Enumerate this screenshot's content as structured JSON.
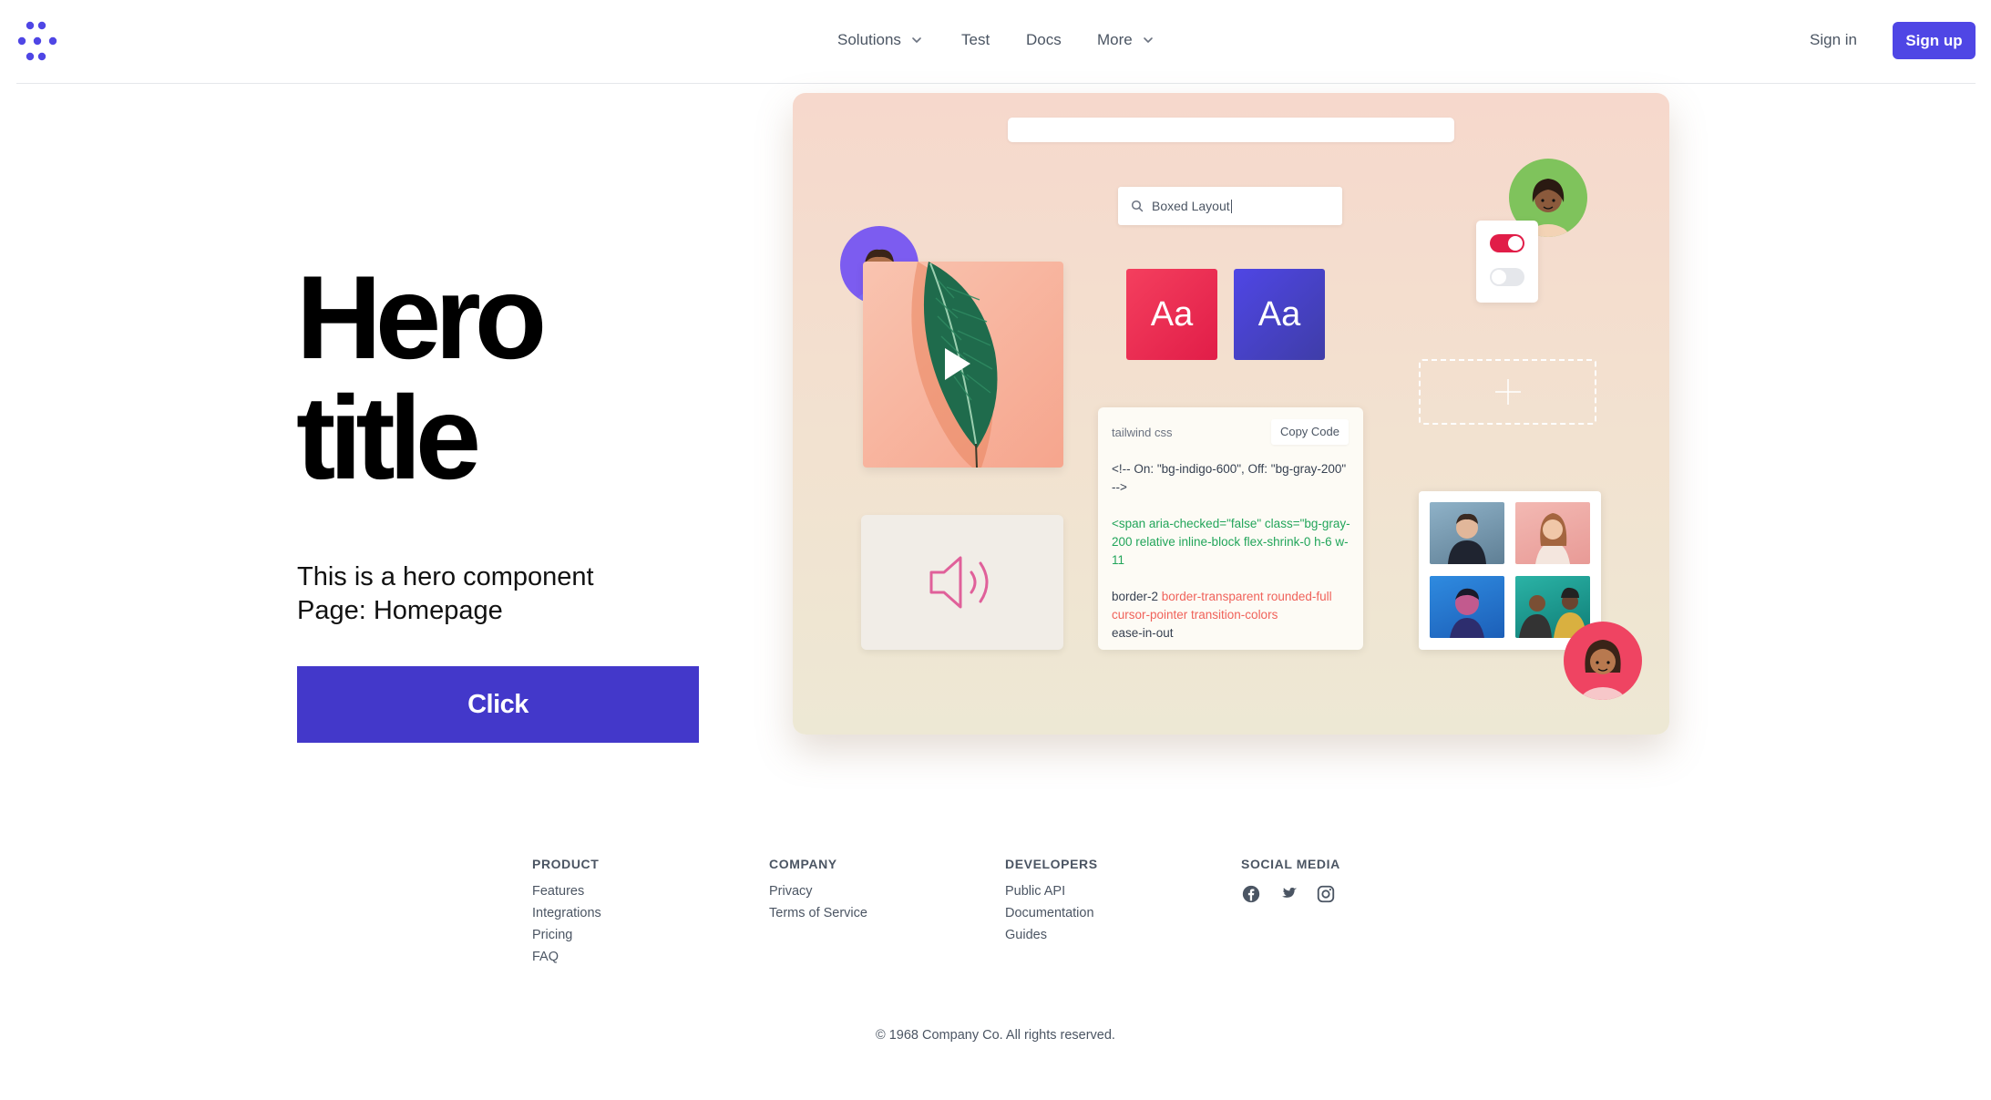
{
  "header": {
    "nav": [
      {
        "label": "Solutions",
        "has_dropdown": true
      },
      {
        "label": "Test",
        "has_dropdown": false
      },
      {
        "label": "Docs",
        "has_dropdown": false
      },
      {
        "label": "More",
        "has_dropdown": true
      }
    ],
    "sign_in": "Sign in",
    "sign_up": "Sign up"
  },
  "hero": {
    "title_line1": "Hero",
    "title_line2": "title",
    "subtitle_line1": "This is a hero component",
    "subtitle_line2": "Page: Homepage",
    "button": "Click"
  },
  "illustration": {
    "search_text": "Boxed Layout",
    "font_sample_1": "Aa",
    "font_sample_2": "Aa",
    "code_label": "tailwind css",
    "copy_button": "Copy Code",
    "code_line_1": "<!-- On: \"bg-indigo-600\", Off: \"bg-gray-200\" -->",
    "code_line_2": "<span aria-checked=\"false\" class=\"bg-gray-200 relative inline-block flex-shrink-0 h-6 w-11",
    "code_line_3a": "border-2 ",
    "code_line_3b": "border-transparent rounded-full cursor-pointer transition-colors",
    "code_line_3c": "ease-in-out",
    "colors": {
      "accent": "#4f46e5",
      "toggle_on": "#e11d48",
      "toggle_off": "#e5e7eb",
      "code_green": "#22a55a",
      "code_red": "#f0625a"
    }
  },
  "footer": {
    "columns": [
      {
        "heading": "PRODUCT",
        "links": [
          "Features",
          "Integrations",
          "Pricing",
          "FAQ"
        ]
      },
      {
        "heading": "COMPANY",
        "links": [
          "Privacy",
          "Terms of Service"
        ]
      },
      {
        "heading": "DEVELOPERS",
        "links": [
          "Public API",
          "Documentation",
          "Guides"
        ]
      }
    ],
    "social_heading": "SOCIAL MEDIA",
    "social_icons": [
      "facebook-icon",
      "twitter-icon",
      "instagram-icon"
    ],
    "copyright": "© 1968 Company Co. All rights reserved."
  }
}
